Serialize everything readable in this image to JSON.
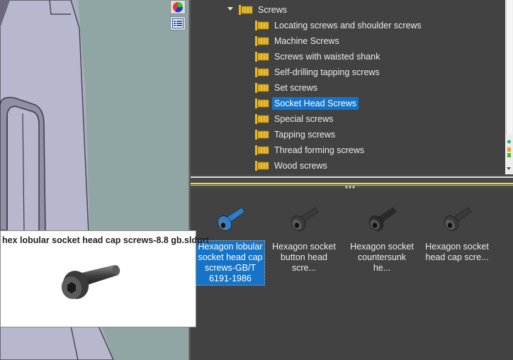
{
  "viewport": {
    "toolbar_icons": [
      "appearance-icon",
      "display-list-icon"
    ]
  },
  "tree": {
    "parent": {
      "label": "Screws",
      "icon": "folder-icon",
      "expanded": true
    },
    "items": [
      {
        "label": "Locating screws and shoulder screws",
        "selected": false
      },
      {
        "label": "Machine Screws",
        "selected": false
      },
      {
        "label": "Screws with waisted shank",
        "selected": false
      },
      {
        "label": "Self-drilling tapping screws",
        "selected": false
      },
      {
        "label": "Set screws",
        "selected": false
      },
      {
        "label": "Socket Head Screws",
        "selected": true
      },
      {
        "label": "Special screws",
        "selected": false
      },
      {
        "label": "Tapping screws",
        "selected": false
      },
      {
        "label": "Thread forming screws",
        "selected": false
      },
      {
        "label": "Wood screws",
        "selected": false
      }
    ]
  },
  "files": [
    {
      "label": "Hexagon lobular socket head cap screws-GB/T 6191-1986",
      "selected": true,
      "color": "#2b7fd0"
    },
    {
      "label": "Hexagon socket button head scre...",
      "selected": false,
      "color": "#3a3a3a"
    },
    {
      "label": "Hexagon socket countersunk he...",
      "selected": false,
      "color": "#2a2a2a"
    },
    {
      "label": "Hexagon socket head cap scre...",
      "selected": false,
      "color": "#3a3a3a"
    }
  ],
  "tooltip": {
    "title": "hex lobular socket head cap screws-8.8 gb.sldprt"
  },
  "colors": {
    "selection": "#1574c8",
    "folder": "#e8b820",
    "panel_bg": "#424242"
  }
}
